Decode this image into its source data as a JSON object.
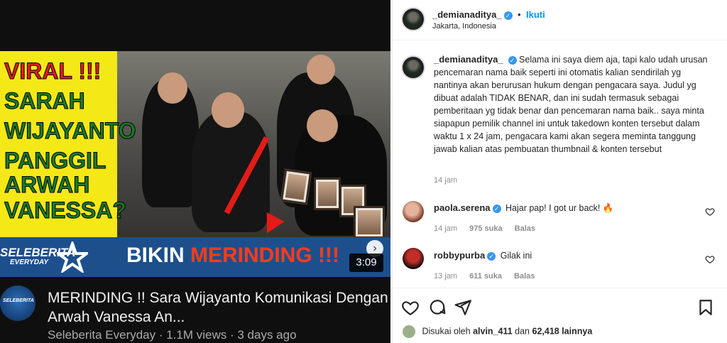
{
  "thumbnail": {
    "headline_lines": [
      "VIRAL !!!",
      "SARAH",
      "WIJAYANTO",
      "PANGGIL",
      "ARWAH",
      "VANESSA?"
    ],
    "brand_name": "SELEBERITA",
    "brand_sub": "EVERYDAY",
    "band_text_1": "BIKIN",
    "band_text_2": "MERINDING !!!",
    "duration": "3:09",
    "next_icon": "chevron-right-icon"
  },
  "video": {
    "channel_avatar_text": "SELEBERITA",
    "title": "MERINDING !! Sara Wijayanto Komunikasi Dengan Arwah Vanessa An...",
    "meta": "Seleberita Everyday · 1.1M views · 3 days ago"
  },
  "post": {
    "username": "_demianaditya_",
    "follow_label": "Ikuti",
    "location": "Jakarta, Indonesia",
    "caption_user": "_demianaditya_",
    "caption": "Selama ini saya diem aja, tapi kalo udah urusan pencemaran nama baik seperti ini otomatis kalian sendirilah yg nantinya akan berurusan hukum dengan pengacara saya. Judul yg dibuat adalah TIDAK BENAR, dan ini sudah termasuk sebagai pemberitaan yg tidak benar dan pencemaran nama baik.. saya minta siapapun pemilik channel ini untuk takedown konten tersebut dalam waktu 1 x 24 jam, pengacara kami akan segera meminta tanggung jawab kalian atas pembuatan thumbnail & konten tersebut",
    "caption_time": "14 jam",
    "comments": [
      {
        "user": "paola.serena",
        "text": "Hajar pap! I got ur back! 🔥",
        "time": "14 jam",
        "likes": "975 suka",
        "reply": "Balas"
      },
      {
        "user": "robbypurba",
        "text": "Gilak ini",
        "time": "13 jam",
        "likes": "611 suka",
        "reply": "Balas"
      }
    ],
    "liked_prefix": "Disukai oleh",
    "liked_user": "alvin_411",
    "liked_mid": "dan",
    "liked_count": "62,418 lainnya"
  },
  "colors": {
    "accent": "#0095f6",
    "verified": "#3897f0",
    "thumb_yellow": "#f5e817",
    "thumb_red": "#ff3b1a"
  }
}
